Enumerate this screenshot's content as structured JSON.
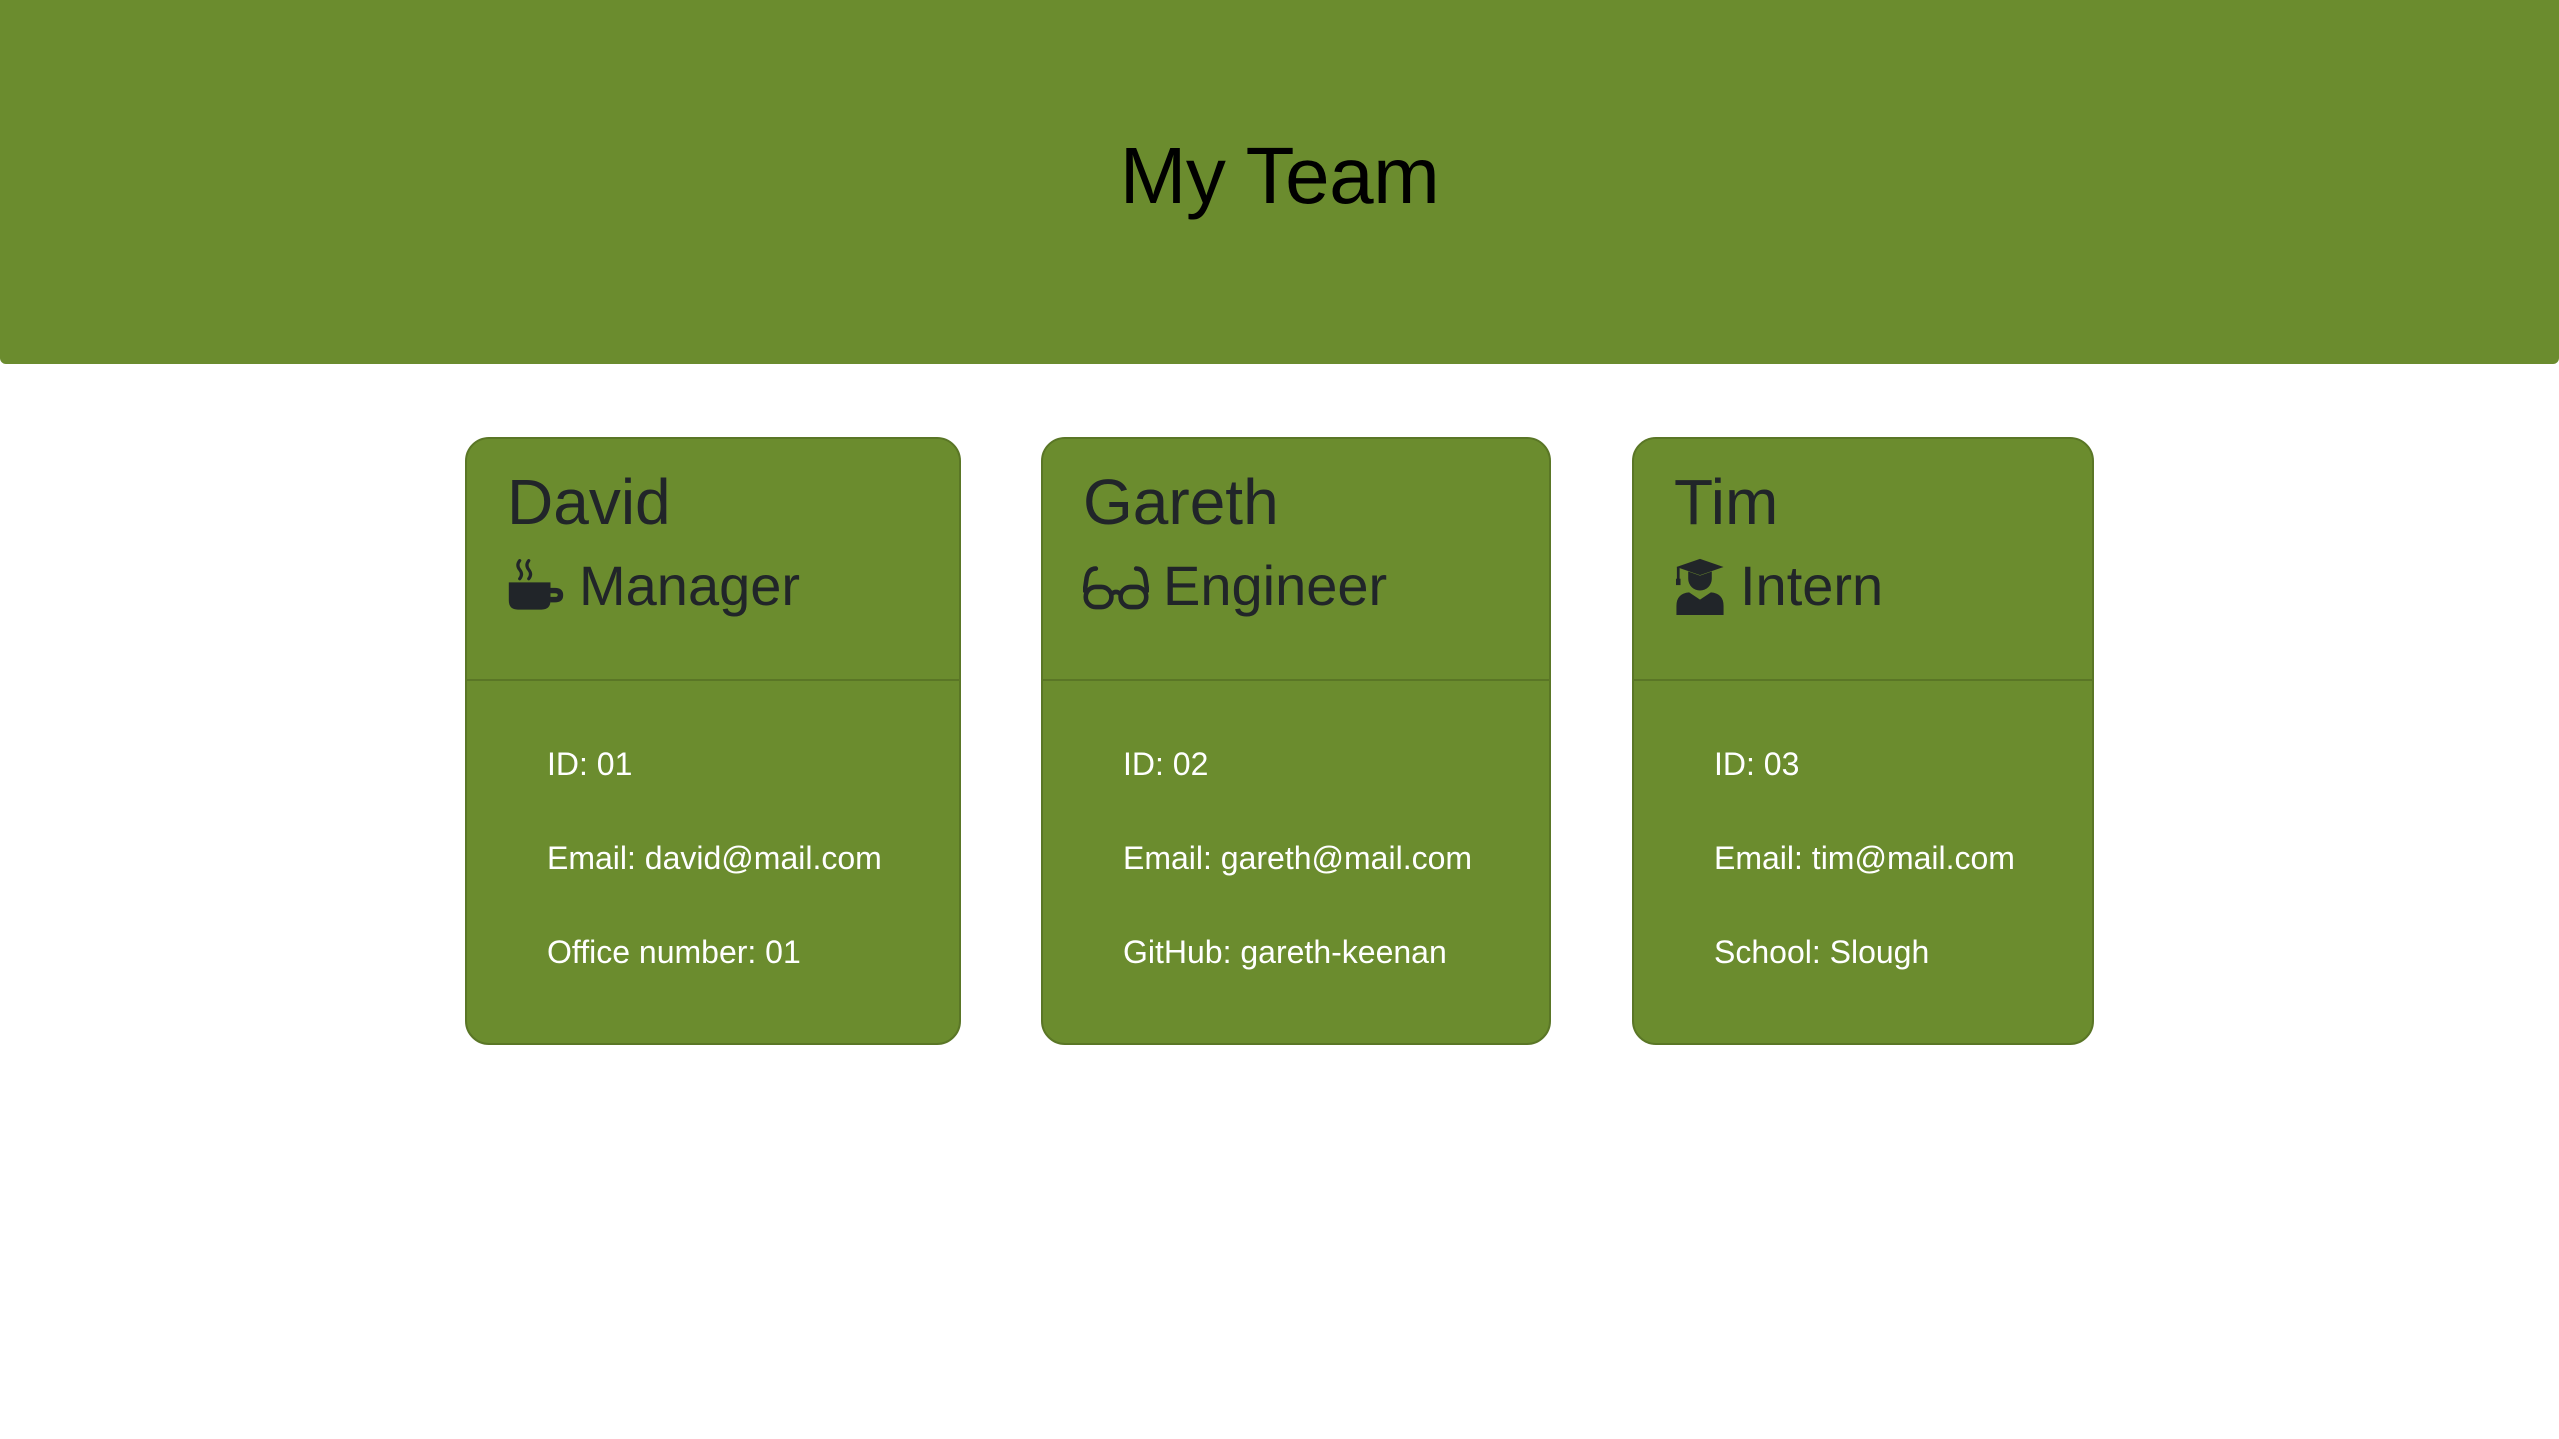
{
  "header": {
    "title": "My Team"
  },
  "colors": {
    "brand_green": "#6b8c2e",
    "card_border": "#5a7626",
    "heading_text": "#212529",
    "body_text": "#ffffff"
  },
  "team": [
    {
      "name": "David",
      "role": "Manager",
      "role_icon": "coffee-mug-icon",
      "id_line": "ID: 01",
      "email_line": "Email: david@mail.com",
      "extra_line": "Office number: 01"
    },
    {
      "name": "Gareth",
      "role": "Engineer",
      "role_icon": "glasses-icon",
      "id_line": "ID: 02",
      "email_line": "Email: gareth@mail.com",
      "extra_line": "GitHub: gareth-keenan"
    },
    {
      "name": "Tim",
      "role": "Intern",
      "role_icon": "graduate-icon",
      "id_line": "ID: 03",
      "email_line": "Email: tim@mail.com",
      "extra_line": "School: Slough"
    }
  ]
}
